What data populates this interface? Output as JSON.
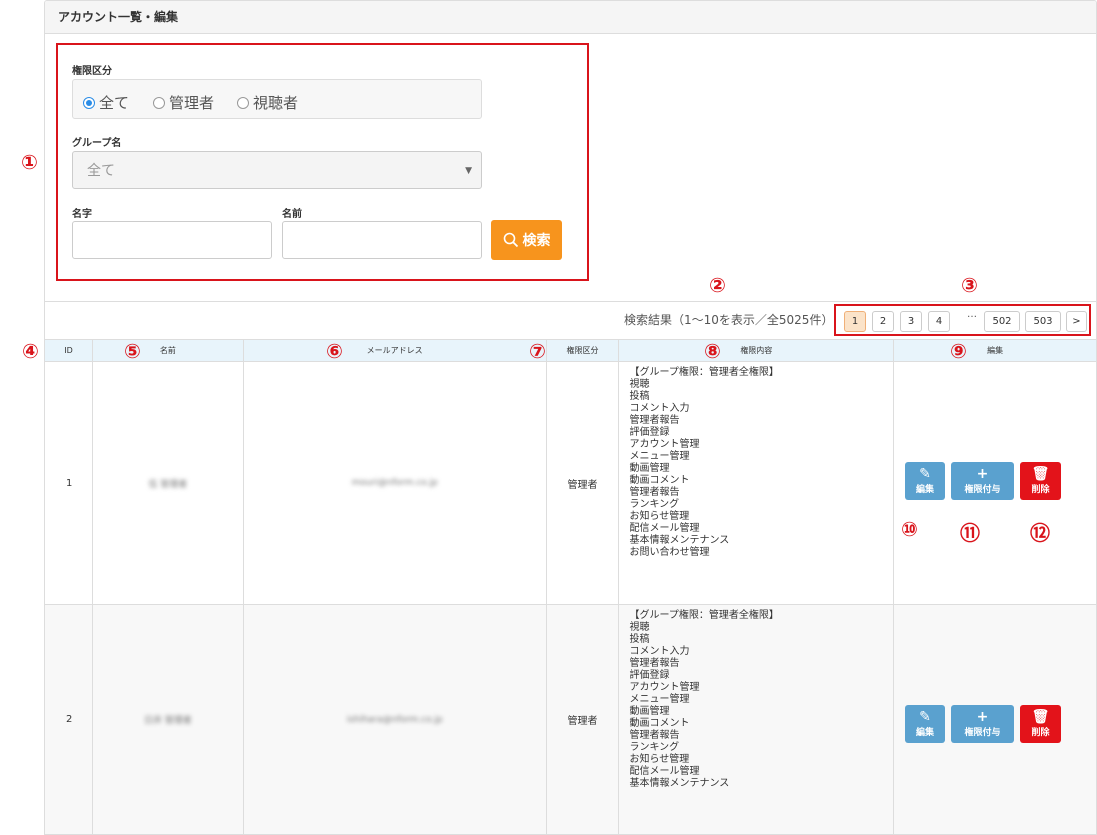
{
  "panel_title": "アカウント一覧・編集",
  "filter": {
    "role_label": "権限区分",
    "roles": [
      "全て",
      "管理者",
      "視聴者"
    ],
    "selected_role": "全て",
    "group_label": "グループ名",
    "group_value": "全て",
    "lastname_label": "名字",
    "firstname_label": "名前",
    "lastname_value": "",
    "firstname_value": "",
    "search_label": "検索"
  },
  "results": {
    "info": "検索結果（1〜10を表示／全5025件）",
    "pages": [
      "1",
      "2",
      "3",
      "4",
      "502",
      "503"
    ],
    "current_page": "1",
    "ellipsis": "…",
    "next": ">"
  },
  "table": {
    "headers": {
      "id": "ID",
      "name": "名前",
      "email": "メールアドレス",
      "role": "権限区分",
      "perms": "権限内容",
      "actions": "編集"
    },
    "rows": [
      {
        "id": "1",
        "name": "伍 管理者",
        "email": "mouri@nform.co.jp",
        "role": "管理者",
        "perms": [
          "【グループ権限：管理者全権限】",
          "視聴",
          "投稿",
          "コメント入力",
          "管理者報告",
          "評価登録",
          "アカウント管理",
          "メニュー管理",
          "動画管理",
          "動画コメント",
          "管理者報告",
          "ランキング",
          "お知らせ管理",
          "配信メール管理",
          "基本情報メンテナンス",
          "お問い合わせ管理"
        ]
      },
      {
        "id": "2",
        "name": "日井 管理者",
        "email": "ishihara@nform.co.jp",
        "role": "管理者",
        "perms": [
          "【グループ権限：管理者全権限】",
          "視聴",
          "投稿",
          "コメント入力",
          "管理者報告",
          "評価登録",
          "アカウント管理",
          "メニュー管理",
          "動画管理",
          "動画コメント",
          "管理者報告",
          "ランキング",
          "お知らせ管理",
          "配信メール管理",
          "基本情報メンテナンス"
        ]
      }
    ],
    "actions": {
      "edit": "編集",
      "grant": "権限付与",
      "delete": "削除"
    }
  },
  "annotations": [
    "①",
    "②",
    "③",
    "④",
    "⑤",
    "⑥",
    "⑦",
    "⑧",
    "⑨",
    "⑩",
    "⑪",
    "⑫"
  ],
  "colors": {
    "accent_orange": "#f7941d",
    "annotation_red": "#d9141b",
    "button_blue": "#5aa1cf",
    "delete_red": "#e3131a",
    "header_blue": "#e8f4fb"
  }
}
